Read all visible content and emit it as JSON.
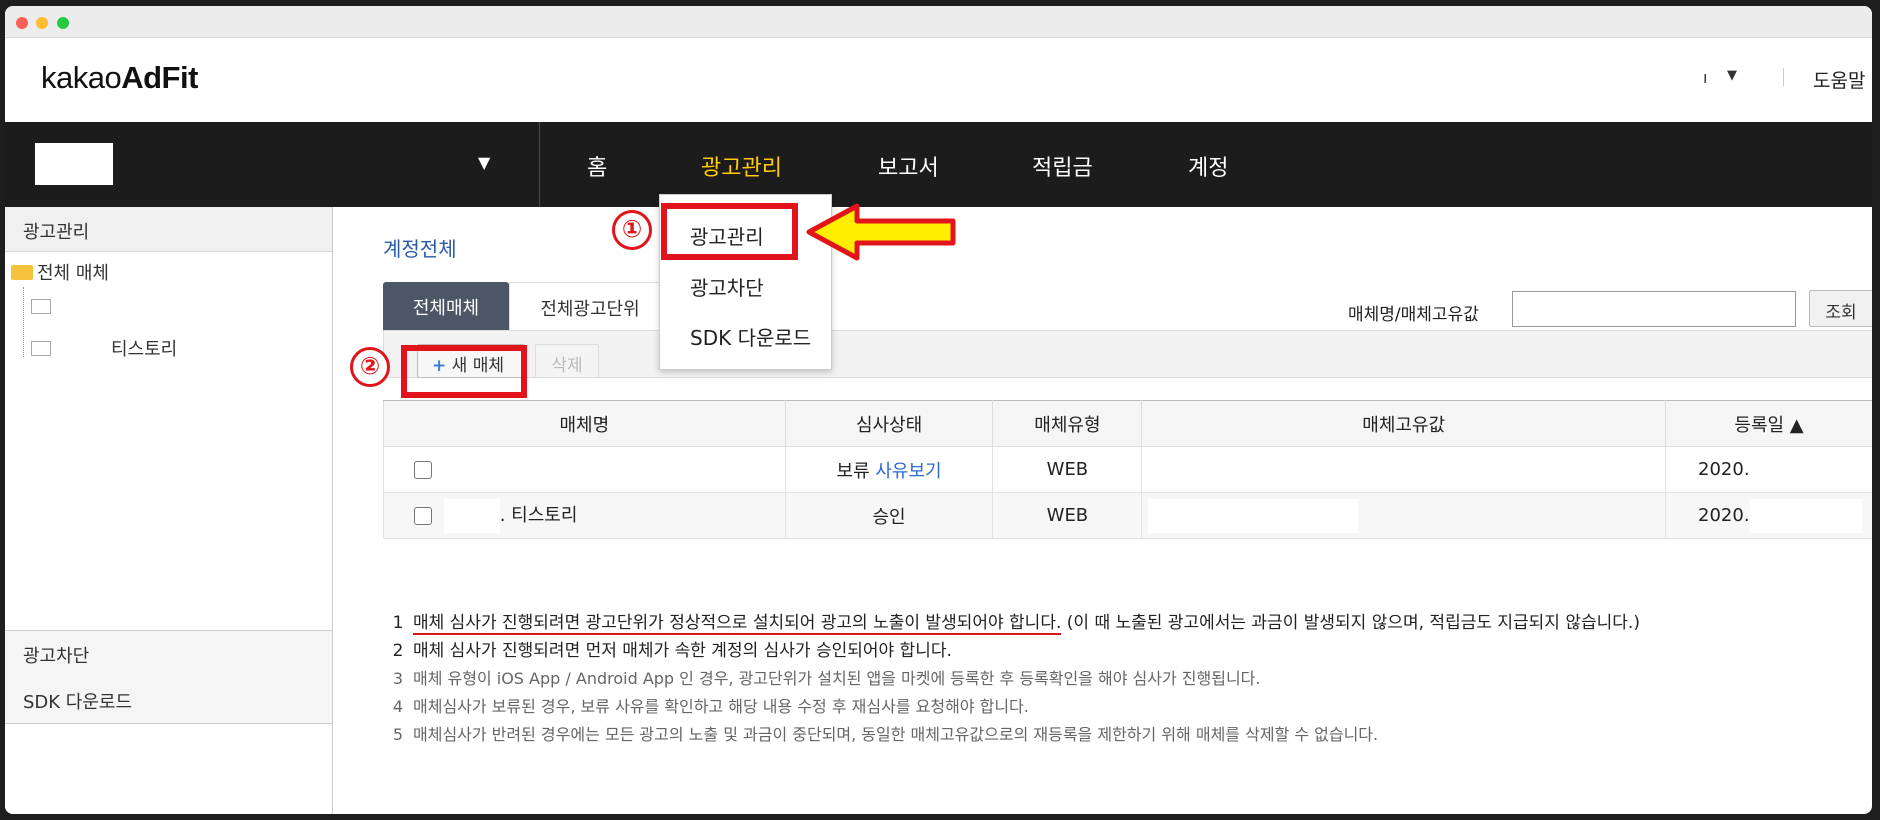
{
  "header": {
    "logo_regular": "kakao",
    "logo_bold": "AdFit",
    "user_menu": "ı",
    "help": "도움말"
  },
  "nav": {
    "items": [
      "홈",
      "광고관리",
      "보고서",
      "적립금",
      "계정"
    ],
    "active": "광고관리"
  },
  "dropdown": {
    "items": [
      "광고관리",
      "광고차단",
      "SDK 다운로드"
    ]
  },
  "sidebar": {
    "section_title": "광고관리",
    "tree_root": "전체 매체",
    "tree_items": [
      "",
      "티스토리"
    ],
    "bottom_items": [
      "광고차단",
      "SDK 다운로드"
    ]
  },
  "main": {
    "breadcrumb": "계정전체",
    "tabs": [
      "전체매체",
      "전체광고단위"
    ],
    "search": {
      "label": "매체명/매체고유값",
      "value": "",
      "button": "조회"
    },
    "toolbar": {
      "new_button": "새 매체",
      "delete_button": "삭제"
    },
    "table": {
      "headers": [
        "매체명",
        "심사상태",
        "매체유형",
        "매체고유값",
        "등록일 ▲"
      ],
      "rows": [
        {
          "name": "",
          "status": "보류",
          "status_link": "사유보기",
          "type": "WEB",
          "unique": "",
          "date": "2020."
        },
        {
          "name": ". 티스토리",
          "status": "승인",
          "status_link": "",
          "type": "WEB",
          "unique": "",
          "date": "2020."
        }
      ]
    },
    "notes": [
      {
        "n": "1",
        "text": "매체 심사가 진행되려면 광고단위가 정상적으로 설치되어 광고의 노출이 발생되어야 합니다.",
        "tail": " (이 때 노출된 광고에서는 과금이 발생되지 않으며, 적립금도 지급되지 않습니다.)"
      },
      {
        "n": "2",
        "text": "매체 심사가 진행되려면 먼저 매체가 속한 계정의 심사가 승인되어야 합니다."
      },
      {
        "n": "3",
        "text": "매체 유형이 iOS App / Android App 인 경우, 광고단위가 설치된 앱을 마켓에 등록한 후 등록확인을 해야 심사가 진행됩니다."
      },
      {
        "n": "4",
        "text": "매체심사가 보류된 경우, 보류 사유를 확인하고 해당 내용 수정 후 재심사를 요청해야 합니다."
      },
      {
        "n": "5",
        "text": "매체심사가 반려된 경우에는 모든 광고의 노출 및 과금이 중단되며, 동일한 매체고유값으로의 재등록을 제한하기 위해 매체를 삭제할 수 없습니다."
      }
    ]
  },
  "annotations": {
    "marker1": "①",
    "marker2": "②"
  },
  "colors": {
    "accent_nav": "#ffcc00",
    "annotation_red": "#e0141a",
    "arrow_yellow": "#ffee00",
    "link_blue": "#2a6bd1"
  }
}
